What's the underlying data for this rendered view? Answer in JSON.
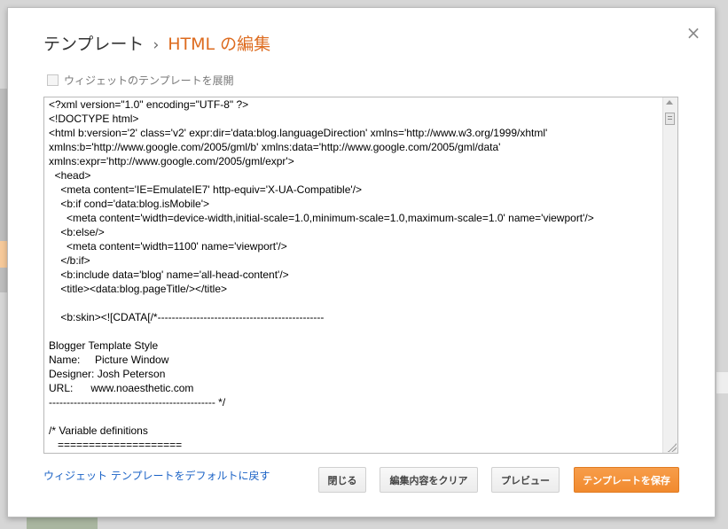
{
  "dialog": {
    "breadcrumb_parent": "テンプレート",
    "breadcrumb_separator": "›",
    "breadcrumb_current": "HTML の編集",
    "close_glyph": "×",
    "expand_widgets_label": "ウィジェットのテンプレートを展開",
    "reset_link": "ウィジェット テンプレートをデフォルトに戻す",
    "buttons": {
      "close": "閉じる",
      "clear": "編集内容をクリア",
      "preview": "プレビュー",
      "save": "テンプレートを保存"
    },
    "colors": {
      "accent": "#dd6b1f",
      "save_button": "#f18a2e",
      "link": "#1a62c6"
    }
  },
  "editor": {
    "lines": [
      "<?xml version=\"1.0\" encoding=\"UTF-8\" ?>",
      "<!DOCTYPE html>",
      "<html b:version='2' class='v2' expr:dir='data:blog.languageDirection' xmlns='http://www.w3.org/1999/xhtml'",
      "xmlns:b='http://www.google.com/2005/gml/b' xmlns:data='http://www.google.com/2005/gml/data'",
      "xmlns:expr='http://www.google.com/2005/gml/expr'>",
      "  <head>",
      "    <meta content='IE=EmulateIE7' http-equiv='X-UA-Compatible'/>",
      "    <b:if cond='data:blog.isMobile'>",
      "      <meta content='width=device-width,initial-scale=1.0,minimum-scale=1.0,maximum-scale=1.0' name='viewport'/>",
      "    <b:else/>",
      "      <meta content='width=1100' name='viewport'/>",
      "    </b:if>",
      "    <b:include data='blog' name='all-head-content'/>",
      "    <title><data:blog.pageTitle/></title>",
      "",
      "    <b:skin><![CDATA[/*-----------------------------------------------",
      "",
      "Blogger Template Style",
      "Name:     Picture Window",
      "Designer: Josh Peterson",
      "URL:      www.noaesthetic.com",
      "----------------------------------------------- */",
      "",
      "/* Variable definitions",
      "   ===================="
    ]
  }
}
